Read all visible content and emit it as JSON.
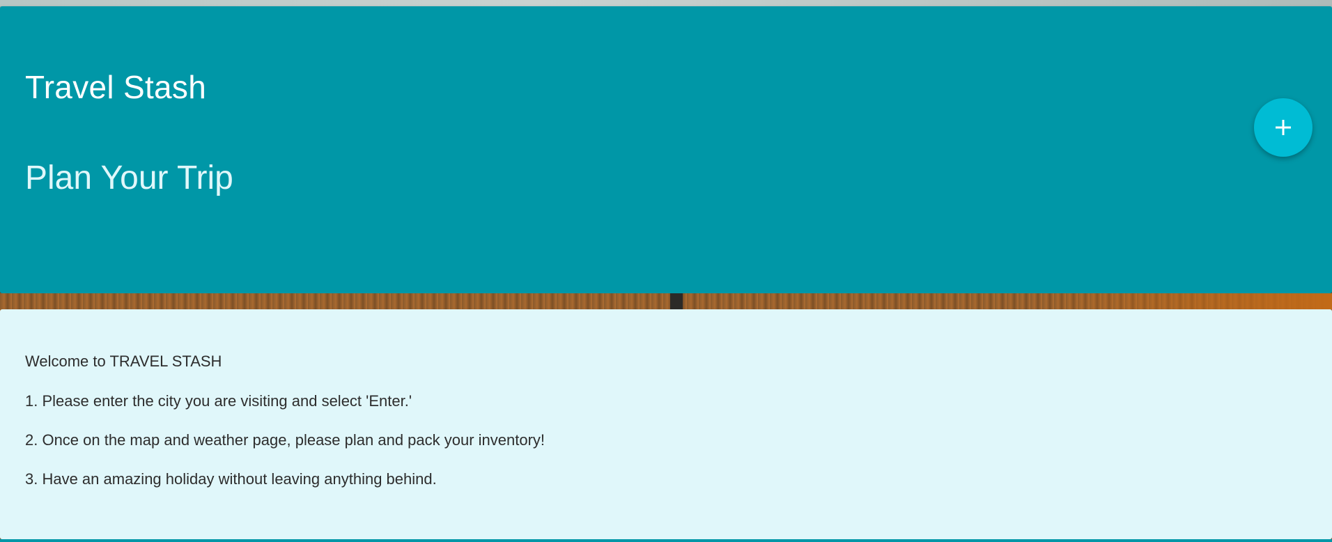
{
  "header": {
    "app_title": "Travel Stash",
    "subtitle": "Plan Your Trip",
    "fab": {
      "icon": "plus-icon",
      "label": "+"
    }
  },
  "intro": {
    "welcome": "Welcome to TRAVEL STASH",
    "steps": [
      "1. Please enter the city you are visiting and select 'Enter.'",
      "2. Once on the map and weather page, please plan and pack your inventory!",
      "3. Have an amazing holiday without leaving anything behind."
    ]
  },
  "colors": {
    "header_bg": "#0097a7",
    "fab_bg": "#00bcd4",
    "content_bg": "#e0f7fa"
  }
}
